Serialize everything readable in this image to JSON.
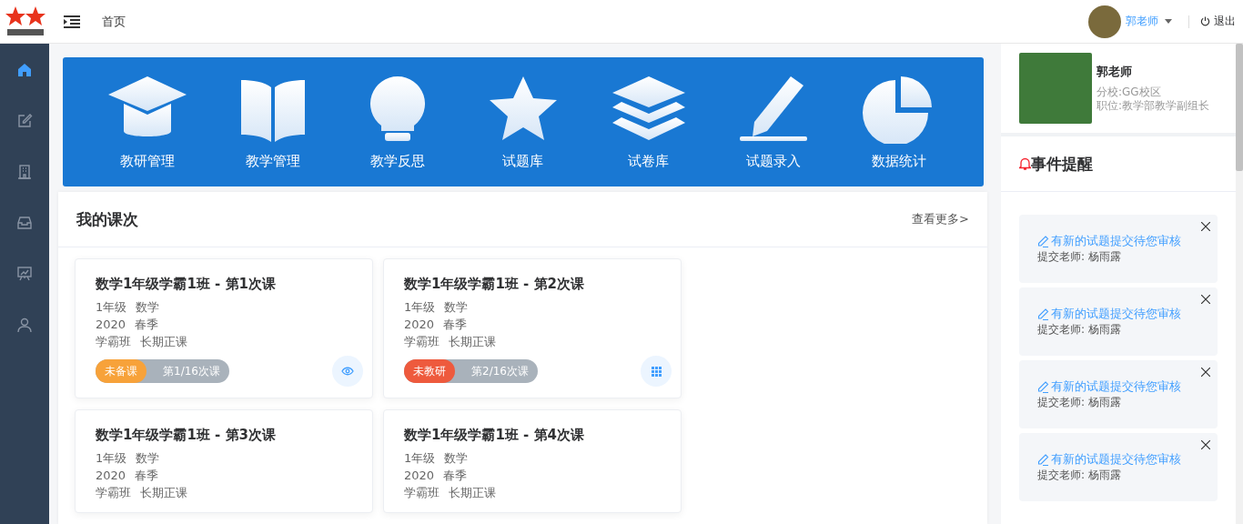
{
  "header": {
    "breadcrumb": "首页",
    "user_name": "郭老师",
    "logout": "退出"
  },
  "sidebar": {
    "items": [
      {
        "selected": true
      },
      {
        "selected": false
      },
      {
        "selected": false
      },
      {
        "selected": false
      },
      {
        "selected": false
      },
      {
        "selected": false
      }
    ]
  },
  "banner": {
    "tiles": [
      {
        "label": "教研管理"
      },
      {
        "label": "教学管理"
      },
      {
        "label": "教学反思"
      },
      {
        "label": "试题库"
      },
      {
        "label": "试卷库"
      },
      {
        "label": "试题录入"
      },
      {
        "label": "数据统计"
      }
    ]
  },
  "courses": {
    "title": "我的课次",
    "more": "查看更多>",
    "cards": [
      {
        "title": "数学1年级学霸1班 - 第1次课",
        "lines": [
          [
            "1年级",
            "数学"
          ],
          [
            "2020",
            "春季"
          ],
          [
            "学霸班",
            "长期正课"
          ]
        ],
        "status": "未备课",
        "color": "#f7a23a",
        "progress": "第1/16次课"
      },
      {
        "title": "数学1年级学霸1班 - 第2次课",
        "lines": [
          [
            "1年级",
            "数学"
          ],
          [
            "2020",
            "春季"
          ],
          [
            "学霸班",
            "长期正课"
          ]
        ],
        "status": "未教研",
        "color": "#ee5a3d",
        "progress": "第2/16次课"
      },
      {
        "title": "数学1年级学霸1班 - 第3次课",
        "lines": [
          [
            "1年级",
            "数学"
          ],
          [
            "2020",
            "春季"
          ],
          [
            "学霸班",
            "长期正课"
          ]
        ]
      },
      {
        "title": "数学1年级学霸1班 - 第4次课",
        "lines": [
          [
            "1年级",
            "数学"
          ],
          [
            "2020",
            "春季"
          ],
          [
            "学霸班",
            "长期正课"
          ]
        ]
      }
    ]
  },
  "profile": {
    "name": "郭老师",
    "branch": "分校:GG校区",
    "position": "职位:教学部教学副组长"
  },
  "events": {
    "title": "事件提醒",
    "items": [
      {
        "message": "有新的试题提交待您审核",
        "submitter": "提交老师: 杨雨露"
      },
      {
        "message": "有新的试题提交待您审核",
        "submitter": "提交老师: 杨雨露"
      },
      {
        "message": "有新的试题提交待您审核",
        "submitter": "提交老师: 杨雨露"
      },
      {
        "message": "有新的试题提交待您审核",
        "submitter": "提交老师: 杨雨露"
      }
    ]
  }
}
